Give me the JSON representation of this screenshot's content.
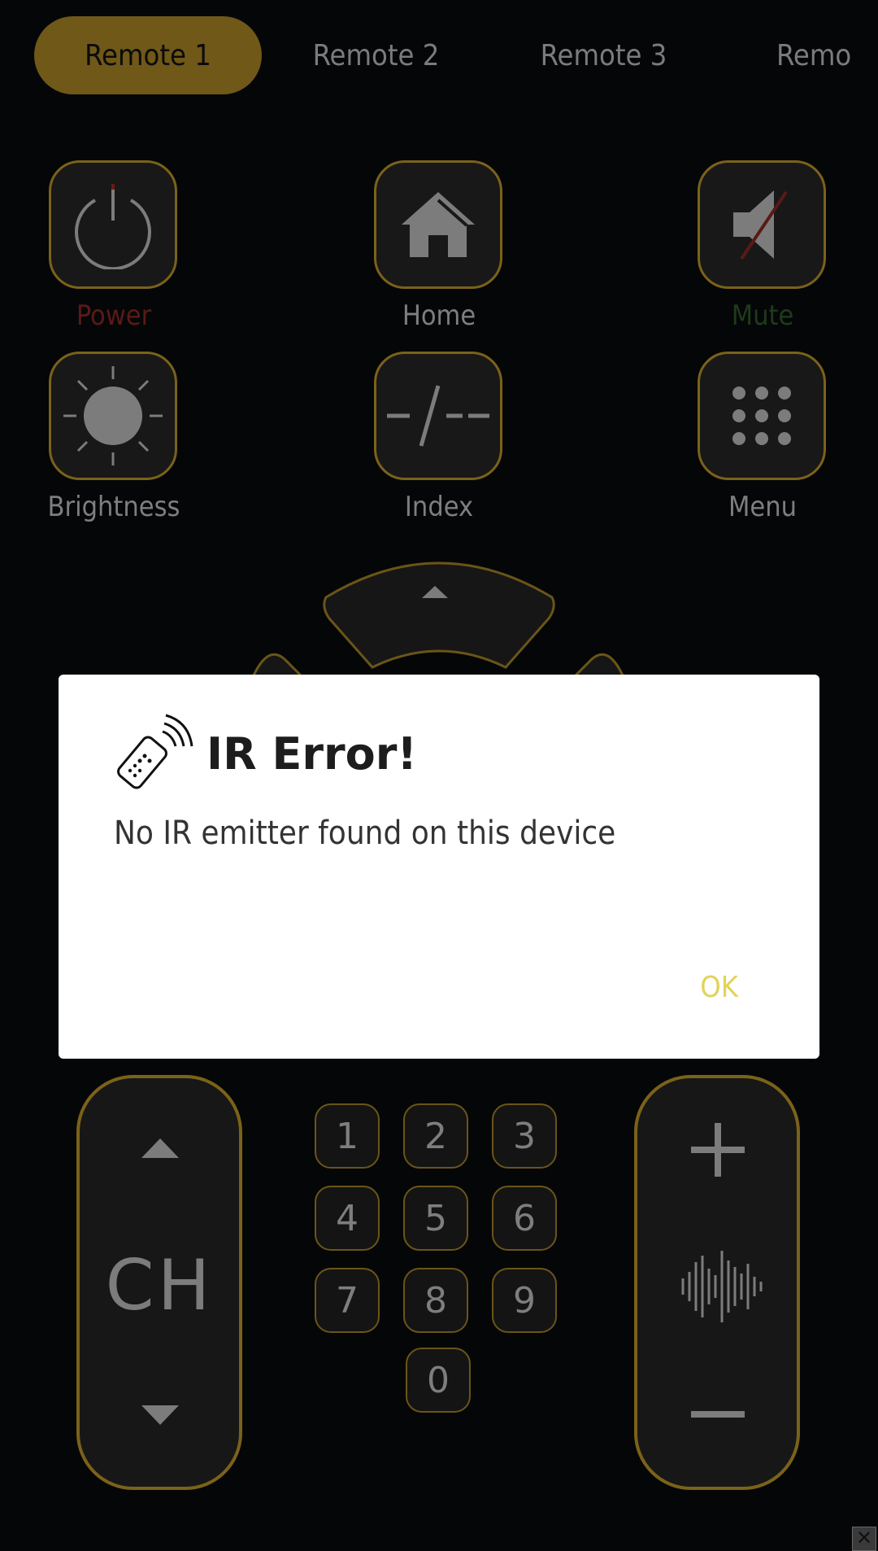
{
  "tabs": [
    {
      "label": "Remote 1",
      "active": true
    },
    {
      "label": "Remote 2",
      "active": false
    },
    {
      "label": "Remote 3",
      "active": false
    },
    {
      "label": "Remo",
      "active": false
    }
  ],
  "buttons": {
    "power": {
      "label": "Power",
      "icon": "power-icon",
      "color": "#5a1a17"
    },
    "home": {
      "label": "Home",
      "icon": "home-icon"
    },
    "mute": {
      "label": "Mute",
      "icon": "mute-icon",
      "color": "#1f3a1c"
    },
    "brightness": {
      "label": "Brightness",
      "icon": "brightness-icon"
    },
    "index": {
      "label": "Index",
      "icon": "index-icon"
    },
    "menu": {
      "label": "Menu",
      "icon": "menu-grid-icon"
    }
  },
  "keypad": [
    "1",
    "2",
    "3",
    "4",
    "5",
    "6",
    "7",
    "8",
    "9",
    "0"
  ],
  "channel": {
    "label": "CH"
  },
  "volume": {
    "icon": "sound-wave-icon"
  },
  "dialog": {
    "title": "IR Error!",
    "message": "No IR emitter found on this device",
    "ok_label": "OK",
    "icon": "remote-control-icon"
  },
  "colors": {
    "accent": "#7a6219",
    "ok": "#e2d35a",
    "background": "#050608"
  }
}
